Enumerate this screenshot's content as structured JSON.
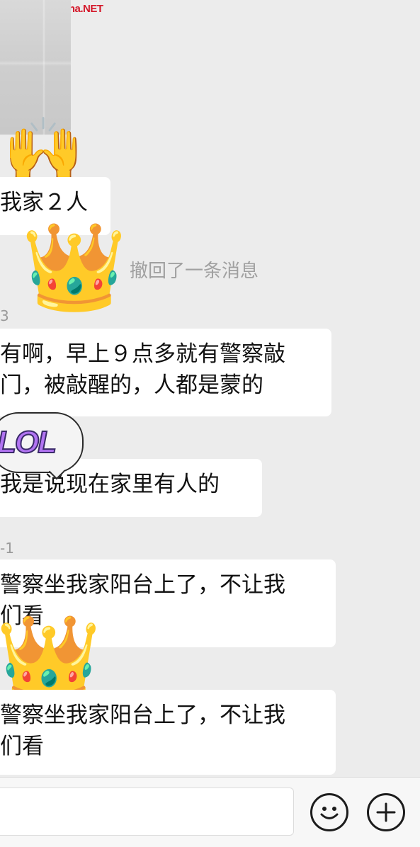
{
  "watermark": "EdmontonChina.NET",
  "icons": {
    "raised_hands": "🙌",
    "crown": "👑",
    "emoji_button": "smiley-face-icon",
    "more_button": "plus-circle-icon"
  },
  "colors": {
    "watermark": "#d4182a",
    "chat_background": "#ececec",
    "bubble": "#ffffff",
    "system_text": "#a0a0a0"
  },
  "messages": [
    {
      "lines": [
        "我家２人"
      ]
    },
    {
      "sender": "3",
      "lines": [
        "有啊，早上９点多就有警察敲",
        "门，被敲醒的，人都是蒙的"
      ]
    },
    {
      "lines": [
        "我是说现在家里有人的"
      ]
    },
    {
      "sender": "-1",
      "lines": [
        "警察坐我家阳台上了，不让我",
        "们看"
      ]
    },
    {
      "lines": [
        "警察坐我家阳台上了，不让我",
        "们看"
      ]
    }
  ],
  "system_notice": "撤回了一条消息",
  "lol_sticker": "LOL",
  "input": {
    "value": ""
  }
}
